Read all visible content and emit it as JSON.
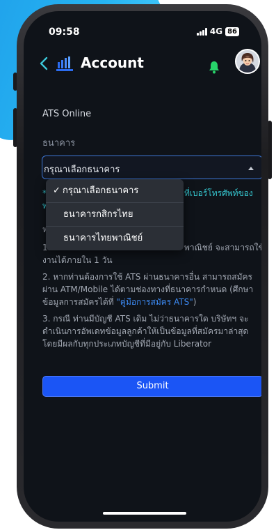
{
  "status_bar": {
    "time": "09:58",
    "network": "4G",
    "battery": "86"
  },
  "header": {
    "title": "Account",
    "back_icon": "chevron-left-icon",
    "notification_icon": "bell-icon"
  },
  "form": {
    "section_title": "ATS Online",
    "bank_label": "ธนาคาร",
    "bank_select_value": "กรุณาเลือกธนาคาร",
    "dropdown_options": [
      "กรุณาเลือกธนาคาร",
      "ธนาคารกสิกรไทย",
      "ธนาคารไทยพาณิชย์"
    ],
    "note_teal_start": "*",
    "note_teal_end": "ที่เบอร์โทรศัพท์ของ",
    "note_teal_line2": "ท",
    "hidden_label_fragment": "ห",
    "info_1_start": "1.",
    "info_1_end": "พาณิชย์ จะสามารถใช้",
    "info_1_line2": "งานได้ภายใน 1 วัน",
    "info_2": "2. หากท่านต้องการใช้ ATS ผ่านธนาคารอื่น สามารถสมัคร ผ่าน ATM/Mobile ได้ตามช่องทางที่ธนาคารกำหนด (ศึกษาข้อมูลการสมัครได้ที่ ",
    "info_2_link": "\"คู่มือการสมัคร ATS\"",
    "info_2_end": ")",
    "info_3": "3. กรณี ท่านมีบัญชี ATS เดิม ไม่ว่าธนาคารใด บริษัทฯ จะดำเนินการอัพเดทข้อมูลลูกค้าให้เป็นข้อมูลที่สมัครมาล่าสุด โดยมีผลกับทุกประเภทบัญชีที่มีอยู่กับ Liberator",
    "submit_label": "Submit"
  },
  "colors": {
    "background": "#0f1319",
    "accent_teal": "#36c6cf",
    "primary_button": "#1b55f5",
    "link": "#3d8bf5",
    "bell": "#27d46a"
  }
}
